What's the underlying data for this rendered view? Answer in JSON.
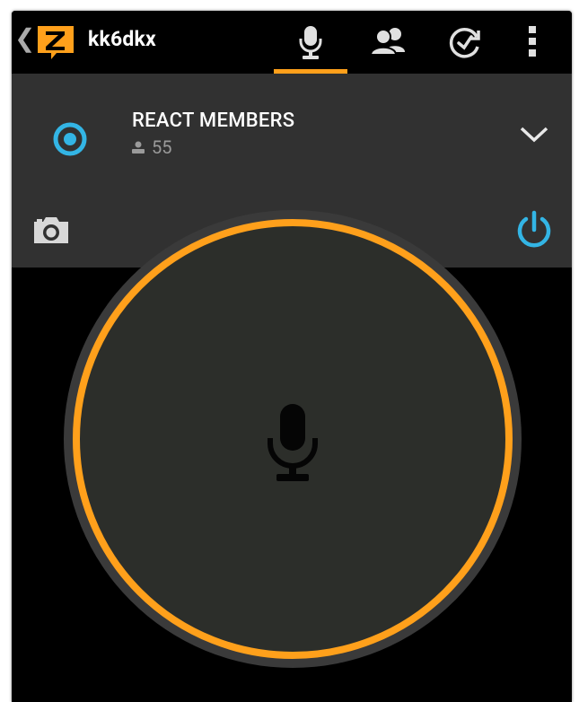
{
  "app": {
    "title": "kk6dkx",
    "back_glyph": "❮",
    "logo_icon": "zello-logo-icon",
    "logo_color": "#ffa01b"
  },
  "tabs": [
    {
      "name": "talk",
      "icon": "microphone-icon",
      "active": true
    },
    {
      "name": "contacts",
      "icon": "contacts-icon",
      "active": false
    },
    {
      "name": "history",
      "icon": "history-icon",
      "active": false
    },
    {
      "name": "menu",
      "icon": "overflow-menu-icon",
      "active": false
    }
  ],
  "channel": {
    "name": "REACT MEMBERS",
    "users_count": "55",
    "status_icon": "channel-status-icon",
    "expand_icon": "chevron-down-icon"
  },
  "controls": {
    "camera_icon": "camera-icon",
    "power_icon": "power-icon"
  },
  "ptt": {
    "icon": "microphone-icon",
    "ring_color": "#ffa01b"
  },
  "colors": {
    "accent": "#ffa01b",
    "status_blue": "#33b5e5",
    "panel": "#313131",
    "background": "#000000"
  }
}
